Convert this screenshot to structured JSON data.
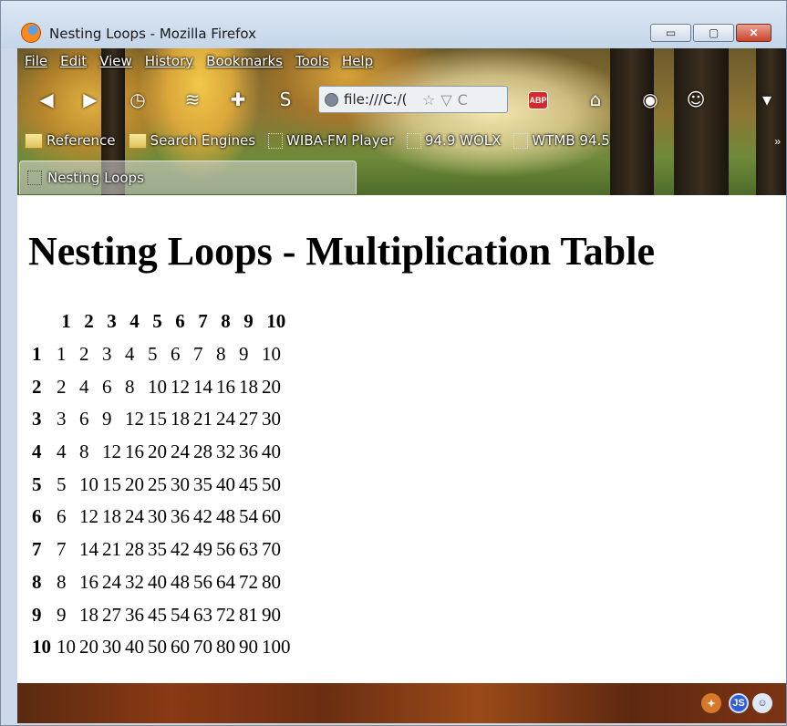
{
  "window": {
    "title": "Nesting Loops - Mozilla Firefox",
    "buttons": {
      "minimize": "▭",
      "maximize": "▢",
      "close": "✕"
    }
  },
  "menu": {
    "items": [
      "File",
      "Edit",
      "View",
      "History",
      "Bookmarks",
      "Tools",
      "Help"
    ]
  },
  "navbar": {
    "back_glyph": "◀",
    "forward_glyph": "▶",
    "history_glyph": "◷",
    "rss_glyph": "≋",
    "addon_glyph": "✚",
    "skype_glyph": "S",
    "url": "file:///C:/(",
    "star_glyph": "☆",
    "dropdown_glyph": "▽",
    "reload_glyph": "C",
    "abp_label": "ABP",
    "home_glyph": "⌂",
    "eye_glyph": "◉",
    "ghost_glyph": "☺",
    "more_glyph": "▾"
  },
  "bookmarks": {
    "items": [
      "Reference",
      "Search Engines",
      "WIBA-FM Player",
      "94.9 WOLX",
      "WTMB 94.5"
    ],
    "overflow": "»"
  },
  "tabs": [
    {
      "label": "Nesting Loops"
    }
  ],
  "page": {
    "title": "Nesting Loops - Multiplication Table",
    "table": {
      "column_headers": [
        "1",
        "2",
        "3",
        "4",
        "5",
        "6",
        "7",
        "8",
        "9",
        "10"
      ],
      "rows": [
        {
          "header": "1",
          "cells": [
            "1",
            "2",
            "3",
            "4",
            "5",
            "6",
            "7",
            "8",
            "9",
            "10"
          ]
        },
        {
          "header": "2",
          "cells": [
            "2",
            "4",
            "6",
            "8",
            "10",
            "12",
            "14",
            "16",
            "18",
            "20"
          ]
        },
        {
          "header": "3",
          "cells": [
            "3",
            "6",
            "9",
            "12",
            "15",
            "18",
            "21",
            "24",
            "27",
            "30"
          ]
        },
        {
          "header": "4",
          "cells": [
            "4",
            "8",
            "12",
            "16",
            "20",
            "24",
            "28",
            "32",
            "36",
            "40"
          ]
        },
        {
          "header": "5",
          "cells": [
            "5",
            "10",
            "15",
            "20",
            "25",
            "30",
            "35",
            "40",
            "45",
            "50"
          ]
        },
        {
          "header": "6",
          "cells": [
            "6",
            "12",
            "18",
            "24",
            "30",
            "36",
            "42",
            "48",
            "54",
            "60"
          ]
        },
        {
          "header": "7",
          "cells": [
            "7",
            "14",
            "21",
            "28",
            "35",
            "42",
            "49",
            "56",
            "63",
            "70"
          ]
        },
        {
          "header": "8",
          "cells": [
            "8",
            "16",
            "24",
            "32",
            "40",
            "48",
            "56",
            "64",
            "72",
            "80"
          ]
        },
        {
          "header": "9",
          "cells": [
            "9",
            "18",
            "27",
            "36",
            "45",
            "54",
            "63",
            "72",
            "81",
            "90"
          ]
        },
        {
          "header": "10",
          "cells": [
            "10",
            "20",
            "30",
            "40",
            "50",
            "60",
            "70",
            "80",
            "90",
            "100"
          ]
        }
      ]
    }
  },
  "statusbar": {
    "icons": [
      "fox-addon-icon",
      "javascript-icon",
      "ghostery-icon"
    ],
    "js_label": "JS",
    "ghost_glyph": "☺",
    "fox_glyph": "✦"
  }
}
